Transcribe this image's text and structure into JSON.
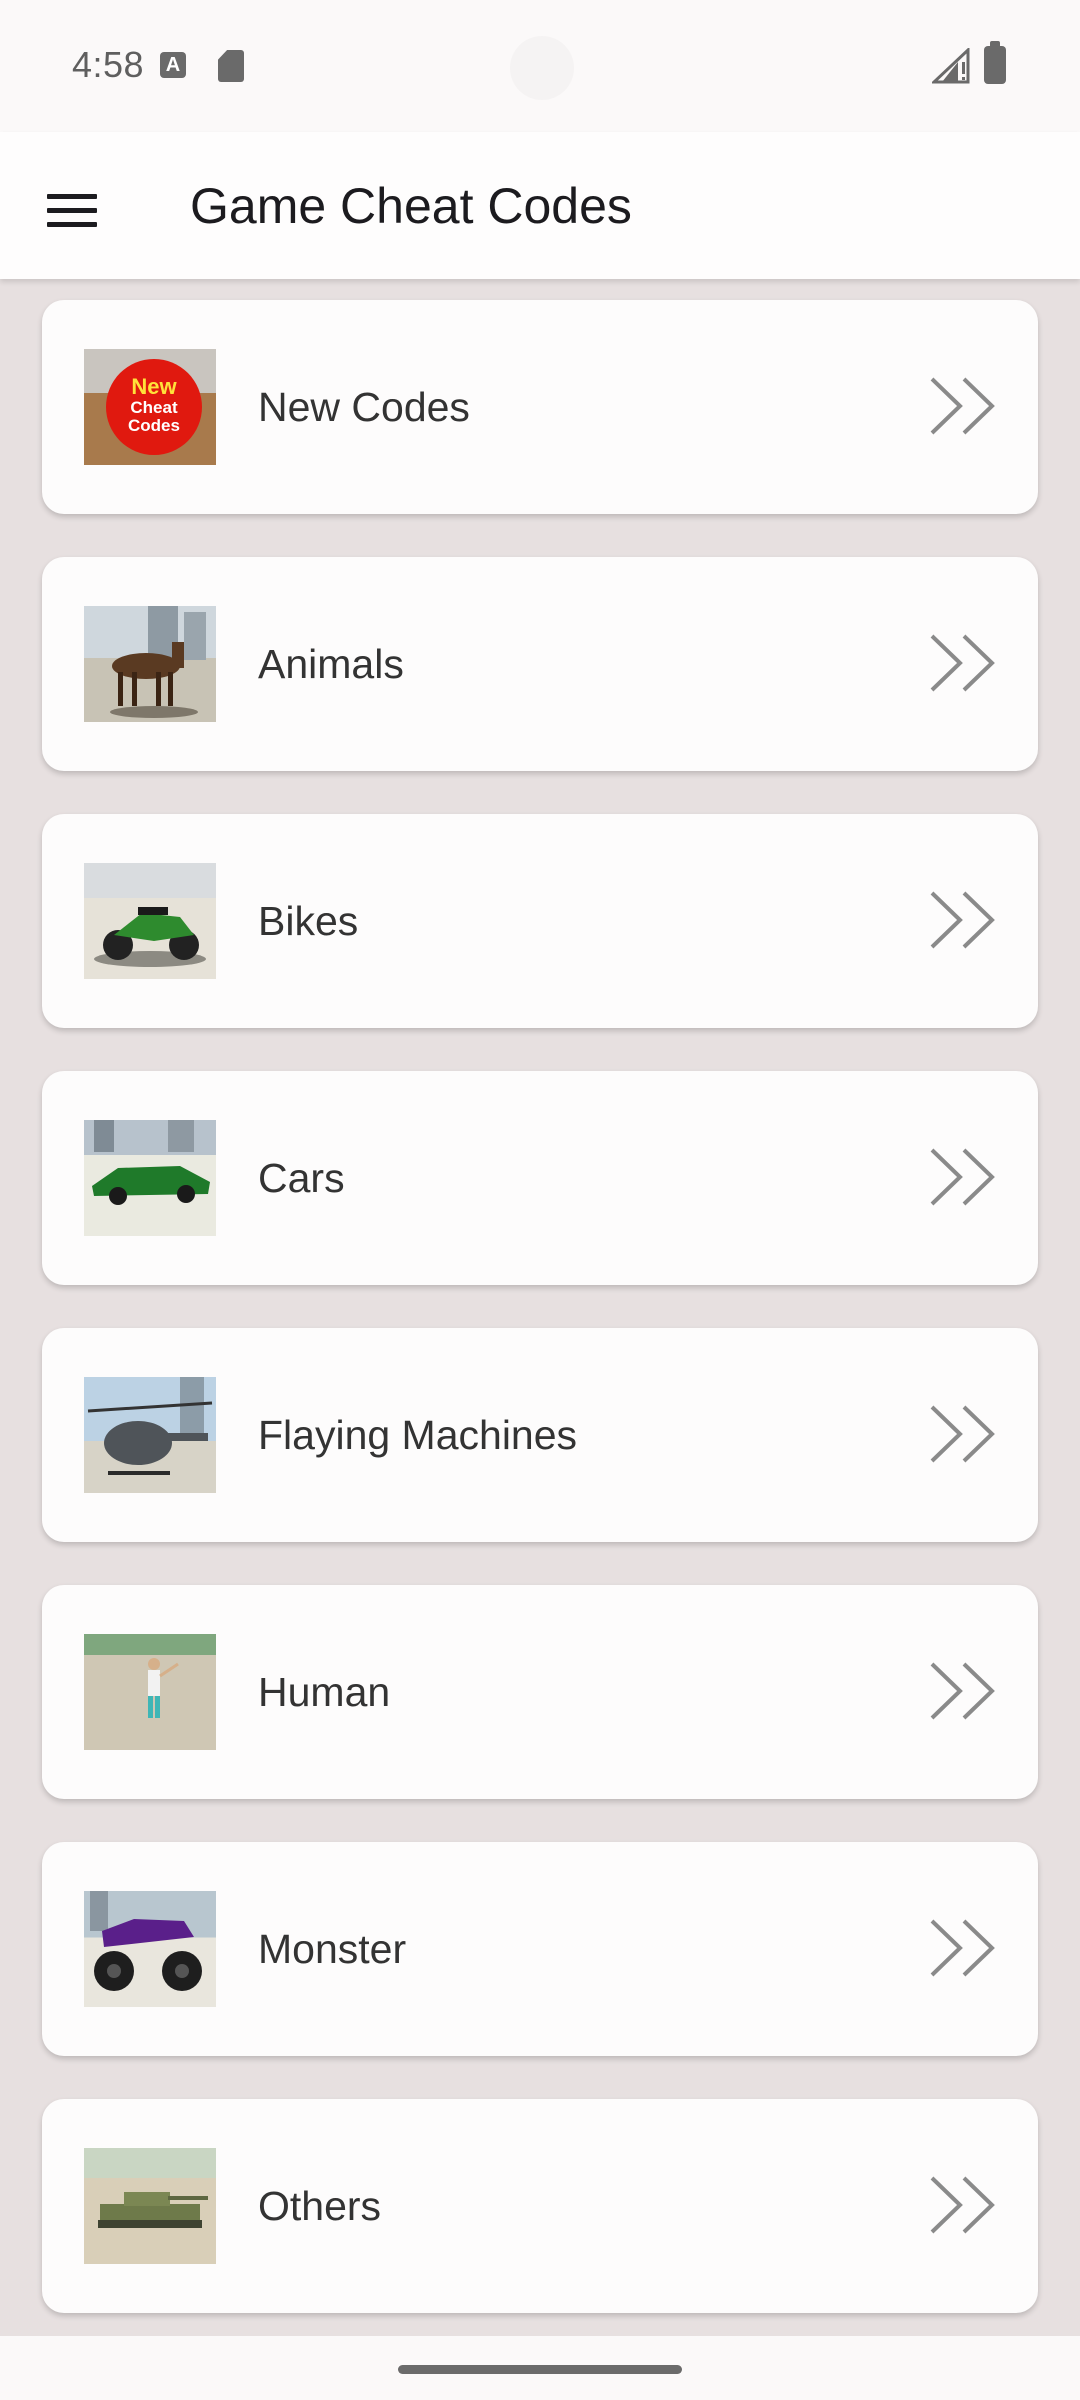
{
  "status_bar": {
    "time": "4:58",
    "icons": [
      "keyboard-a-icon",
      "sd-card-icon",
      "signal-icon",
      "battery-icon"
    ]
  },
  "app_bar": {
    "title": "Game Cheat Codes",
    "menu_icon": "hamburger-menu-icon"
  },
  "categories": [
    {
      "label": "New Codes",
      "thumb": "new-codes-thumbnail"
    },
    {
      "label": "Animals",
      "thumb": "horse-thumbnail"
    },
    {
      "label": "Bikes",
      "thumb": "motorbike-thumbnail"
    },
    {
      "label": "Cars",
      "thumb": "car-thumbnail"
    },
    {
      "label": "Flaying Machines",
      "thumb": "helicopter-thumbnail"
    },
    {
      "label": "Human",
      "thumb": "human-thumbnail"
    },
    {
      "label": "Monster",
      "thumb": "monster-truck-thumbnail"
    },
    {
      "label": "Others",
      "thumb": "tank-thumbnail"
    }
  ],
  "badge": {
    "line1": "New",
    "line2": "Cheat",
    "line3": "Codes"
  },
  "colors": {
    "background": "#e7e0e0",
    "card": "#fdfcfc",
    "text": "#333333",
    "chevron": "#8a8a8a",
    "title": "#1c1b1f"
  }
}
